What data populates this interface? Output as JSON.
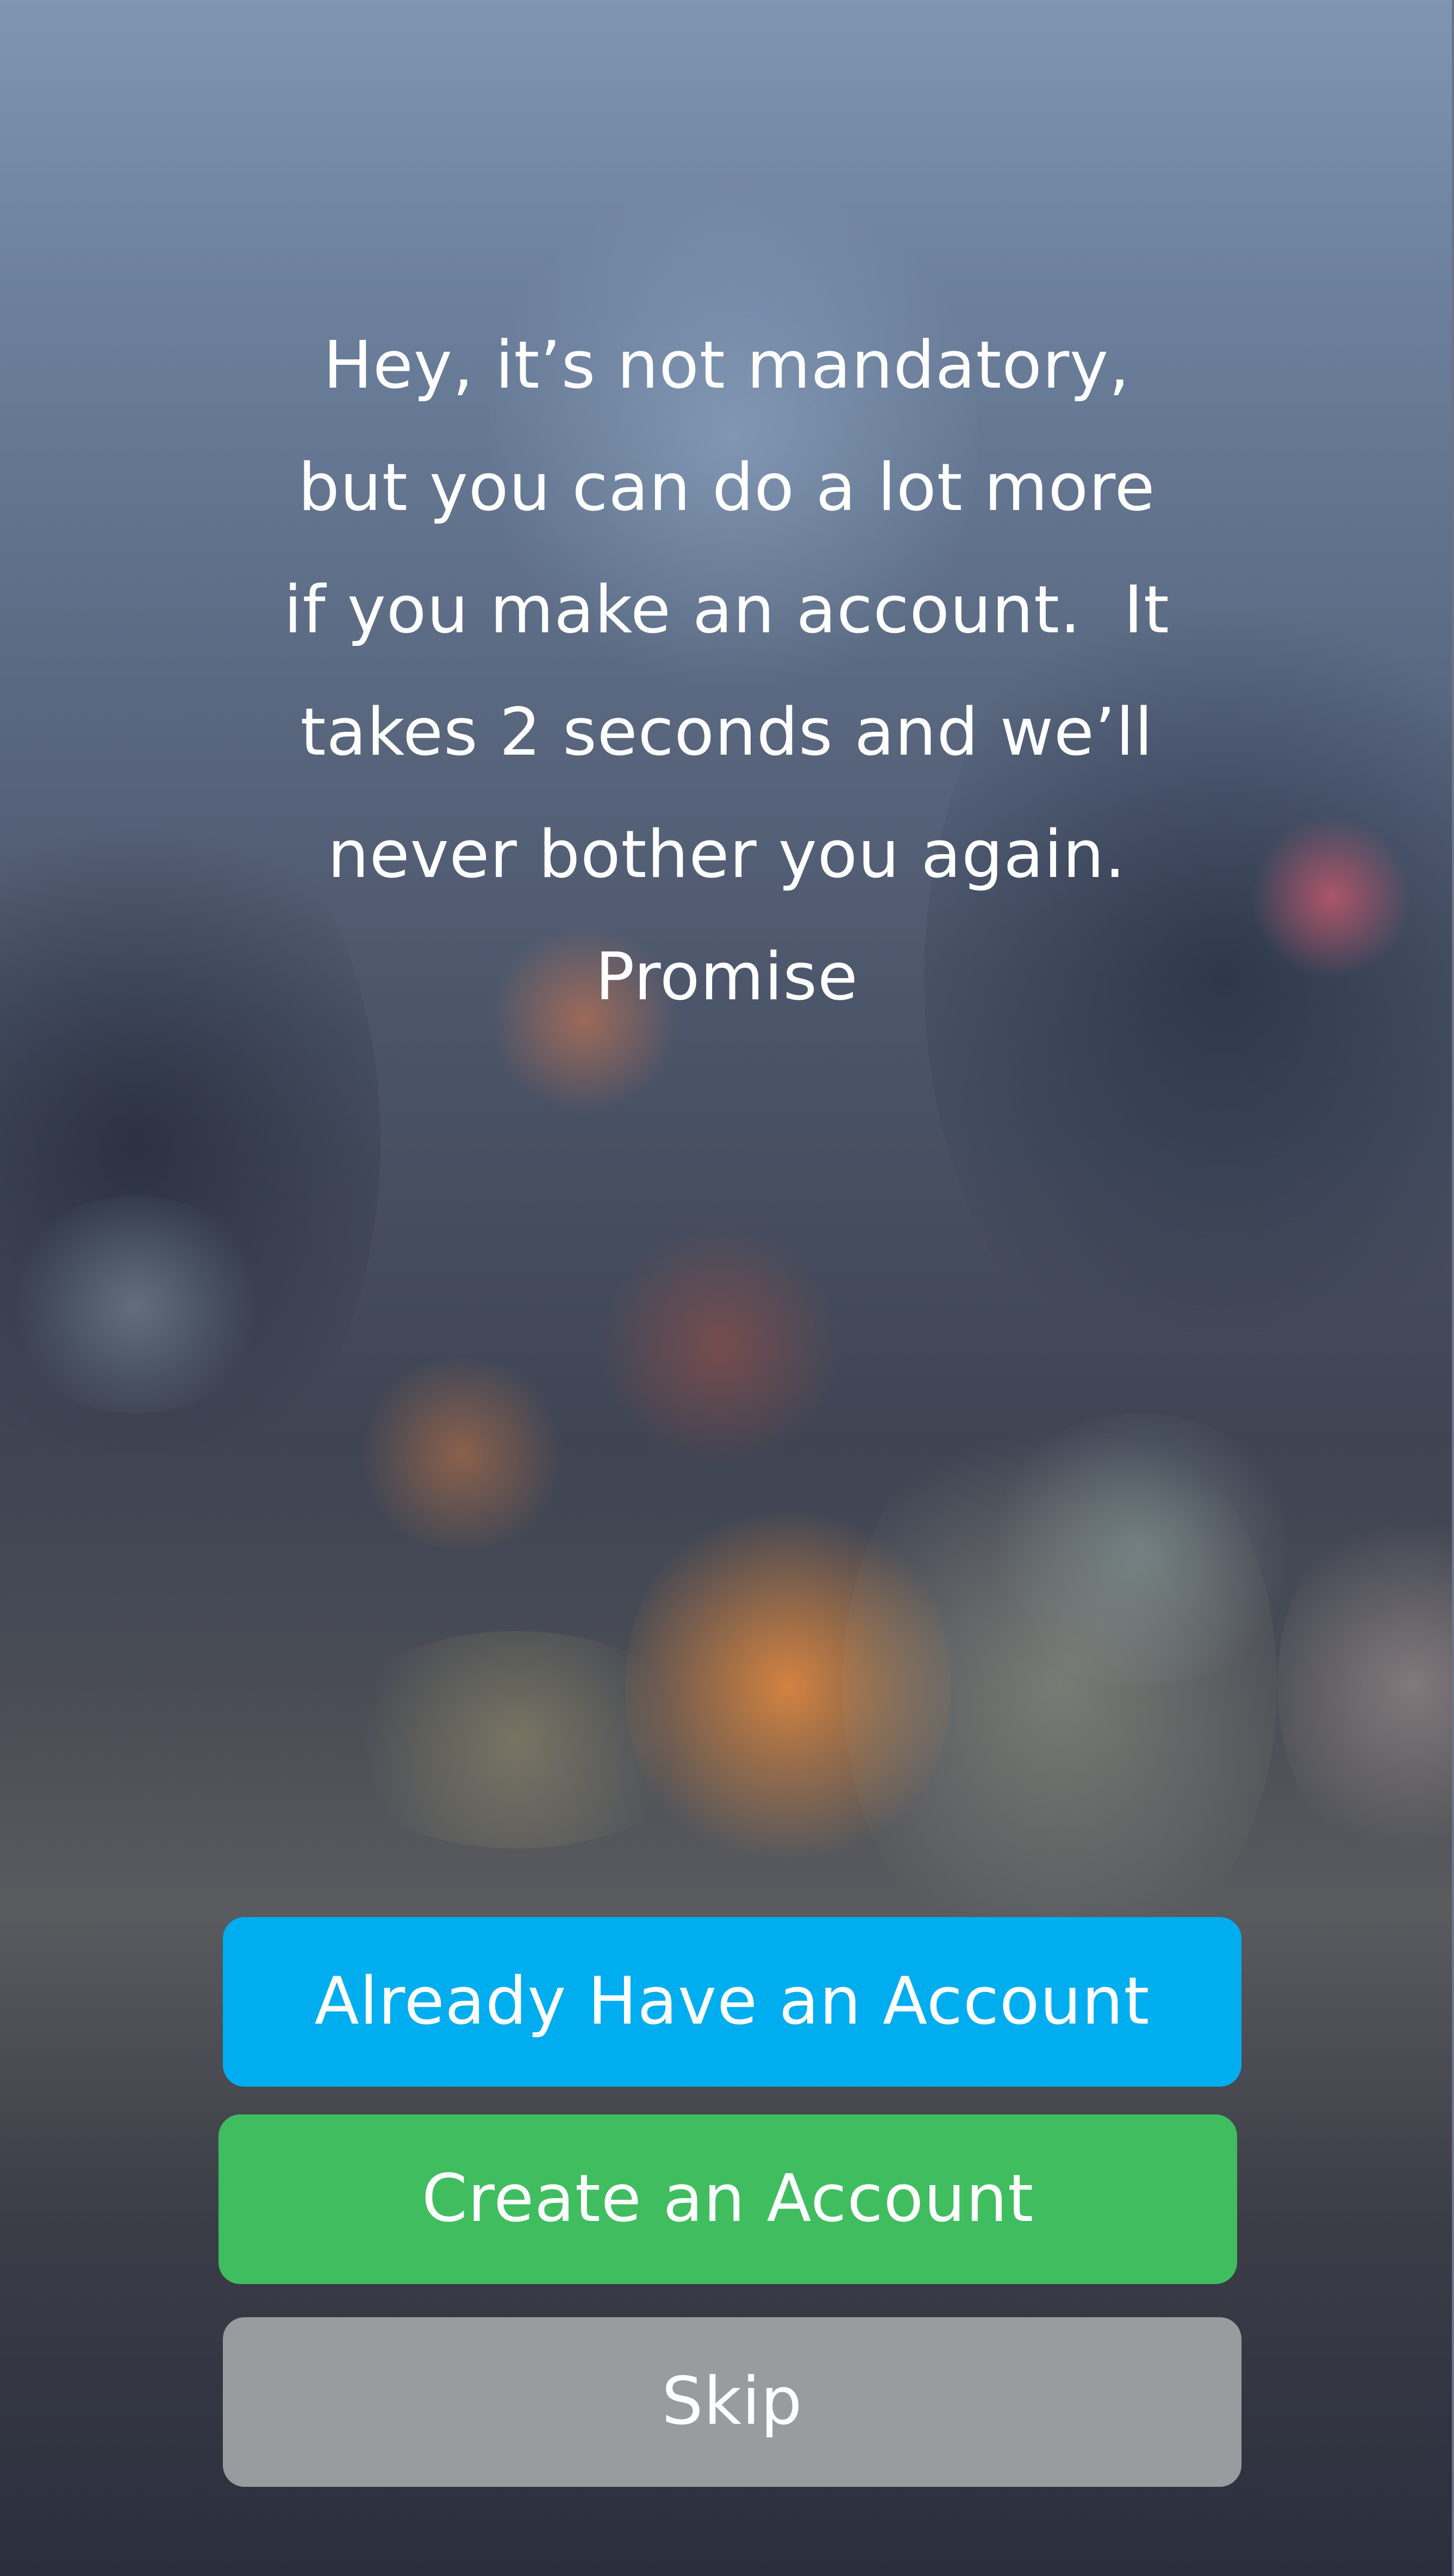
{
  "message": {
    "lines": [
      "Hey, it’s not mandatory,",
      "but you can do a lot more",
      "if you make an account.  It",
      "takes 2 seconds and we’ll",
      "never bother you again.",
      "Promise"
    ]
  },
  "buttons": {
    "login_label": "Already Have an Account",
    "create_label": "Create an Account",
    "skip_label": "Skip"
  },
  "colors": {
    "login_button": "#00adef",
    "create_button": "#3fbd5f",
    "skip_button": "#989c9f",
    "text": "#ffffff"
  }
}
